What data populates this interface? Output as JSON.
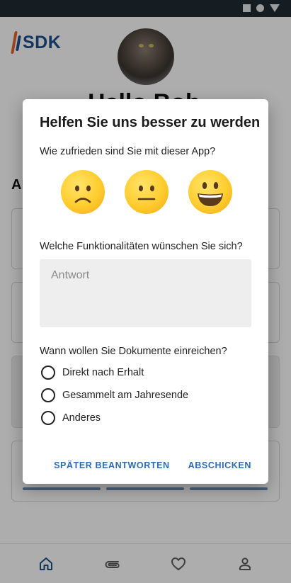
{
  "status_bar": {
    "icons": [
      "square-icon",
      "circle-icon",
      "triangle-icon"
    ]
  },
  "background": {
    "logo": {
      "text": "SDK"
    },
    "greeting": "Hallo Bob",
    "section_heading": "Ak"
  },
  "bottom_nav": {
    "items": [
      {
        "icon": "home-icon",
        "active": true
      },
      {
        "icon": "paperclip-icon",
        "active": false
      },
      {
        "icon": "heart-icon",
        "active": false
      },
      {
        "icon": "person-icon",
        "active": false
      }
    ]
  },
  "dialog": {
    "title": "Helfen Sie uns besser zu werden",
    "question_satisfaction": "Wie zufrieden sind Sie mit dieser App?",
    "emojis": [
      "sad-face-icon",
      "neutral-face-icon",
      "happy-face-icon"
    ],
    "question_features": "Welche Funktionalitäten wünschen Sie sich?",
    "answer_placeholder": "Antwort",
    "question_documents": "Wann wollen Sie Dokumente einreichen?",
    "options": [
      "Direkt nach Erhalt",
      "Gesammelt am Jahresende",
      "Anderes"
    ],
    "later_button": "SPÄTER BEANTWORTEN",
    "submit_button": "ABSCHICKEN"
  },
  "colors": {
    "accent": "#2e6bb2",
    "logo_blue": "#1d4f8c",
    "logo_orange": "#e8622a",
    "emoji_yellow": "#ffcc2e",
    "status_bar": "#1f2a33"
  }
}
